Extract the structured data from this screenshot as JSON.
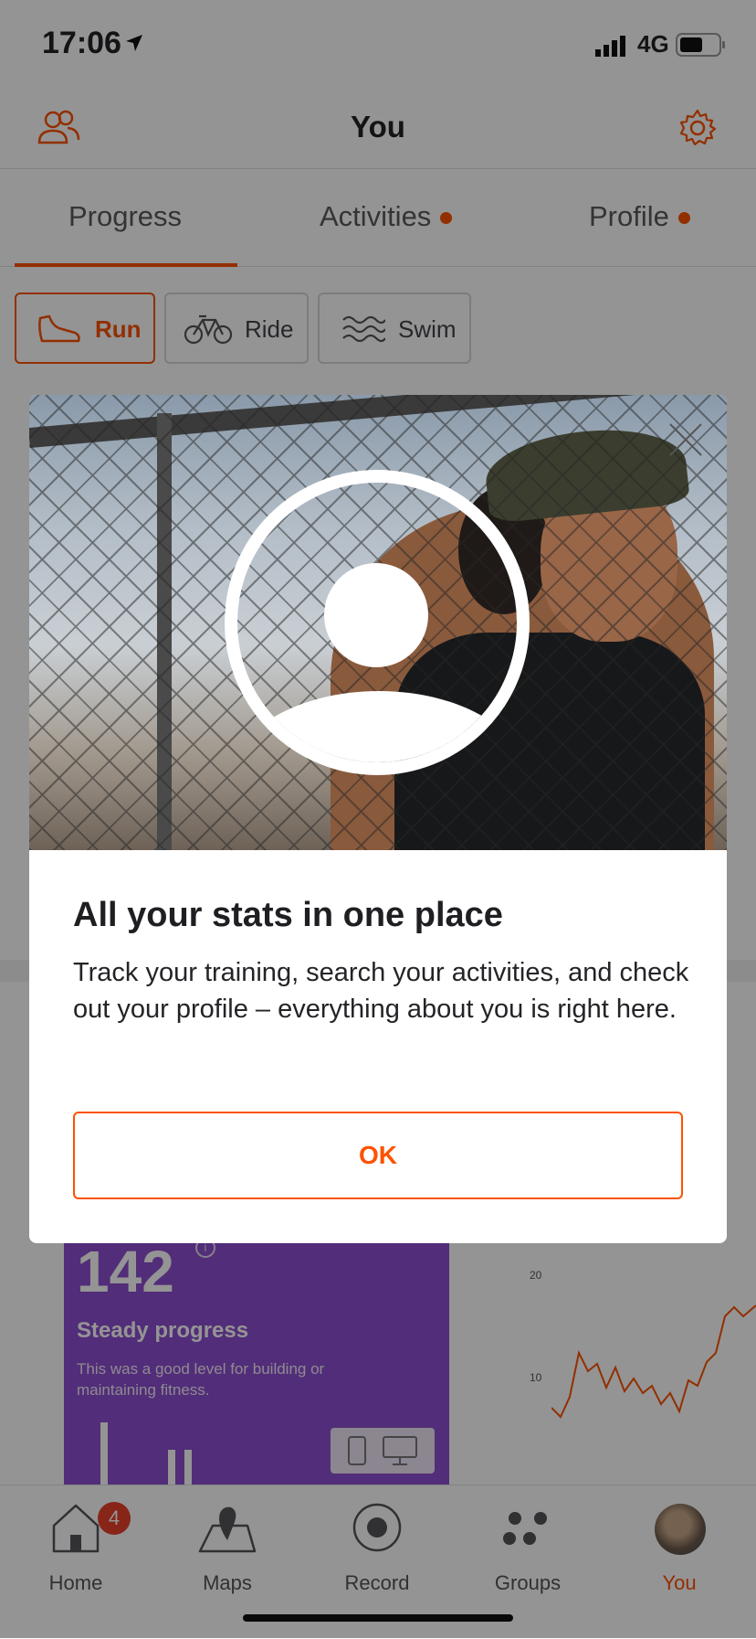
{
  "status_bar": {
    "time": "17:06",
    "network": "4G"
  },
  "header": {
    "title": "You"
  },
  "tabs": [
    {
      "label": "Progress",
      "selected": true
    },
    {
      "label": "Activities",
      "has_dot": true
    },
    {
      "label": "Profile",
      "has_dot": true
    }
  ],
  "sports": [
    {
      "label": "Run",
      "icon": "shoe-icon",
      "selected": true
    },
    {
      "label": "Ride",
      "icon": "bike-icon"
    },
    {
      "label": "Swim",
      "icon": "waves-icon"
    }
  ],
  "background_card": {
    "value": "142",
    "info": "i",
    "heading": "Steady progress",
    "description": "This was a good level for building or maintaining fitness."
  },
  "background_chart": {
    "ticks": [
      "20",
      "10"
    ]
  },
  "modal": {
    "title": "All your stats in one place",
    "text": "Track your training, search your activities, and check out your profile – everything about you is right here.",
    "button": "OK"
  },
  "nav": [
    {
      "label": "Home",
      "icon": "home-icon",
      "badge": "4"
    },
    {
      "label": "Maps",
      "icon": "map-pin-icon"
    },
    {
      "label": "Record",
      "icon": "record-icon"
    },
    {
      "label": "Groups",
      "icon": "groups-icon"
    },
    {
      "label": "You",
      "icon": "avatar",
      "active": true
    }
  ],
  "colors": {
    "accent": "#fc5200",
    "badge": "#e8412c",
    "card": "#8d4fd0"
  }
}
